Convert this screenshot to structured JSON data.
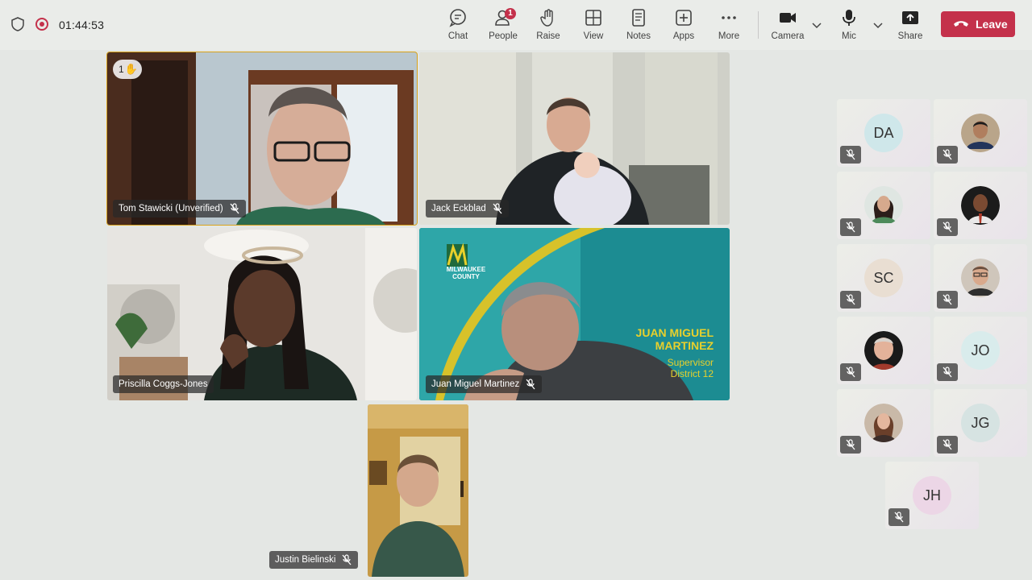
{
  "meeting": {
    "timer": "01:44:53"
  },
  "toolbar": {
    "chat": "Chat",
    "people": "People",
    "people_badge": "1",
    "raise": "Raise",
    "view": "View",
    "notes": "Notes",
    "apps": "Apps",
    "more": "More",
    "camera": "Camera",
    "mic": "Mic",
    "share": "Share",
    "leave": "Leave"
  },
  "tiles": {
    "tom": {
      "name": "Tom Stawicki (Unverified)",
      "hand_count": "1"
    },
    "jack": {
      "name": "Jack Eckblad"
    },
    "priscilla": {
      "name": "Priscilla Coggs-Jones"
    },
    "juan": {
      "name": "Juan Miguel Martinez",
      "bg_logo_line1": "MILWAUKEE",
      "bg_logo_line2": "COUNTY",
      "bg_title_line1": "JUAN MIGUEL",
      "bg_title_line2": "MARTINEZ",
      "bg_role_line1": "Supervisor",
      "bg_role_line2": "District 12"
    },
    "justin": {
      "name": "Justin Bielinski"
    }
  },
  "roster": {
    "da": "DA",
    "sc": "SC",
    "jo": "JO",
    "jg": "JG",
    "jh": "JH"
  },
  "colors": {
    "leave": "#c4314b",
    "highlight": "#d9a21b",
    "teal_bg": "#1c8c92"
  }
}
